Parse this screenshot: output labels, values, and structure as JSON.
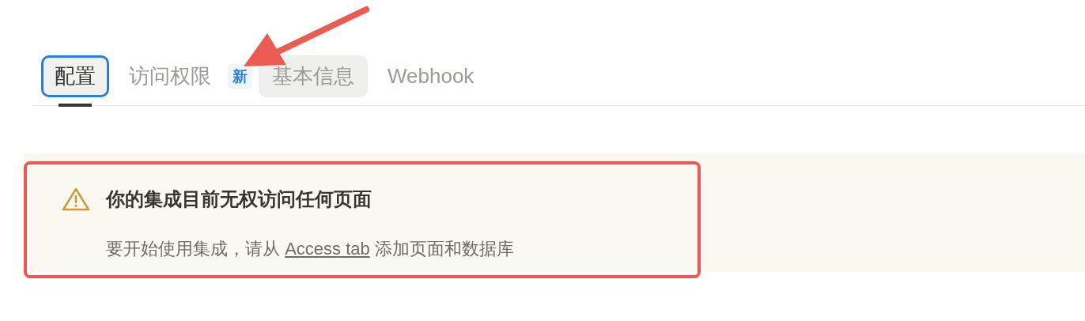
{
  "tabs": [
    {
      "label": "配置",
      "selected": true,
      "focused": true,
      "hovered": false
    },
    {
      "label": "访问权限",
      "selected": false,
      "focused": false,
      "hovered": false,
      "badge": "新"
    },
    {
      "label": "基本信息",
      "selected": false,
      "focused": false,
      "hovered": true
    },
    {
      "label": "Webhook",
      "selected": false,
      "focused": false,
      "hovered": false
    }
  ],
  "callout": {
    "title": "你的集成目前无权访问任何页面",
    "text_before": "要开始使用集成，请从",
    "link": "Access tab",
    "text_after": "添加页面和数据库",
    "highlighted": true
  }
}
